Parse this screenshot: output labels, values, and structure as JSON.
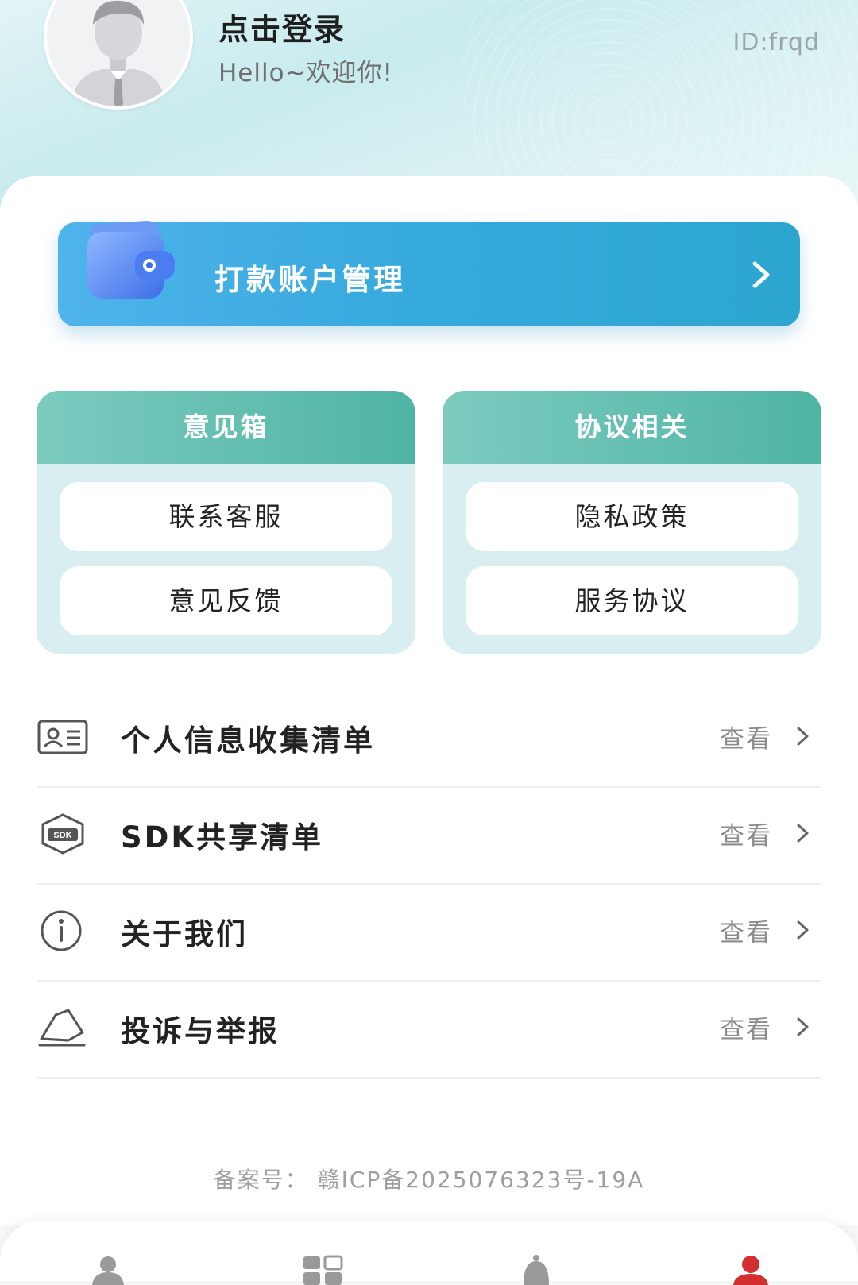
{
  "profile": {
    "login_title": "点击登录",
    "greeting": "Hello~欢迎你!",
    "user_id": "ID:frqd",
    "avatar_icon": "default-avatar-icon"
  },
  "account_banner": {
    "label": "打款账户管理",
    "icon": "wallet-icon"
  },
  "panels": [
    {
      "title": "意见箱",
      "buttons": [
        "联系客服",
        "意见反馈"
      ]
    },
    {
      "title": "协议相关",
      "buttons": [
        "隐私政策",
        "服务协议"
      ]
    }
  ],
  "list": [
    {
      "icon": "id-card-icon",
      "label": "个人信息收集清单",
      "action": "查看"
    },
    {
      "icon": "sdk-icon",
      "label": "SDK共享清单",
      "action": "查看"
    },
    {
      "icon": "info-icon",
      "label": "关于我们",
      "action": "查看"
    },
    {
      "icon": "complaint-icon",
      "label": "投诉与举报",
      "action": "查看"
    }
  ],
  "icp": "备案号： 赣ICP备2025076323号-19A",
  "tabbar": {
    "items": [
      {
        "icon": "profile-tab-icon",
        "active": false
      },
      {
        "icon": "apps-tab-icon",
        "active": false
      },
      {
        "icon": "bell-tab-icon",
        "active": false
      },
      {
        "icon": "mine-tab-icon",
        "active": true
      }
    ],
    "active_color": "#d32f2f",
    "inactive_color": "#9a9a9a"
  },
  "colors": {
    "accent_blue": "#35a9dc",
    "accent_teal": "#4fb4a5",
    "panel_bg": "#d9eef0"
  }
}
